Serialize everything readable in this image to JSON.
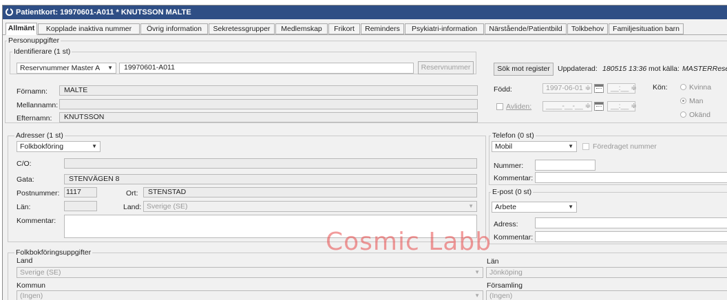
{
  "window": {
    "title": "Patientkort: 19970601-A011 * KNUTSSON MALTE"
  },
  "tabs": [
    {
      "label": "Allmänt"
    },
    {
      "label": "Kopplade inaktiva nummer"
    },
    {
      "label": "Övrig information"
    },
    {
      "label": "Sekretessgrupper"
    },
    {
      "label": "Medlemskap"
    },
    {
      "label": "Frikort"
    },
    {
      "label": "Reminders"
    },
    {
      "label": "Psykiatri-information"
    },
    {
      "label": "Närstående/Patientbild"
    },
    {
      "label": "Tolkbehov"
    },
    {
      "label": "Familjesituation barn"
    }
  ],
  "person": {
    "legend": "Personuppgifter",
    "identifiers_legend": "Identifierare (1 st)",
    "id_type": "Reservnummer Master A",
    "id_value": "19970601-A011",
    "reserve_button": "Reservnummer",
    "search_button": "Sök mot register",
    "updated_label": "Uppdaterad:",
    "updated_value": "180515 13:36",
    "source_label": "mot källa:",
    "source_value": "MASTERReserv",
    "first_name_label": "Förnamn:",
    "first_name": "MALTE",
    "middle_name_label": "Mellannamn:",
    "middle_name": "",
    "last_name_label": "Efternamn:",
    "last_name": "KNUTSSON",
    "born_label": "Född:",
    "born_date": "1997-06-01",
    "born_time": "__:__",
    "deceased_label": "Avliden:",
    "deceased_date": "____-__-__",
    "deceased_time": "__:__",
    "gender_label": "Kön:",
    "gender_options": [
      "Kvinna",
      "Man",
      "Okänd"
    ],
    "gender_selected": "Man"
  },
  "addresses": {
    "legend": "Adresser (1 st)",
    "type": "Folkbokföring",
    "co_label": "C/O:",
    "co": "",
    "street_label": "Gata:",
    "street": "STENVÄGEN 8",
    "postal_label": "Postnummer:",
    "postal": "1117",
    "city_label": "Ort:",
    "city": "STENSTAD",
    "county_label": "Län:",
    "county": "",
    "country_label": "Land:",
    "country": "Sverige (SE)",
    "comment_label": "Kommentar:",
    "comment": ""
  },
  "phone": {
    "legend": "Telefon (0 st)",
    "type": "Mobil",
    "preferred_label": "Föredraget nummer",
    "number_label": "Nummer:",
    "number": "",
    "comment_label": "Kommentar:",
    "comment": ""
  },
  "email": {
    "legend": "E-post (0 st)",
    "type": "Arbete",
    "address_label": "Adress:",
    "address": "",
    "comment_label": "Kommentar:",
    "comment": ""
  },
  "registry": {
    "legend": "Folkbokföringsuppgifter",
    "country_label": "Land",
    "country": "Sverige (SE)",
    "county_label": "Län",
    "county": "Jönköping",
    "municipality_label": "Kommun",
    "municipality": "(Ingen)",
    "parish_label": "Församling",
    "parish": "(Ingen)"
  },
  "watermark": "Cosmic Labb",
  "colors": {
    "titlebar": "#2e4e85",
    "watermark": "#e84a4a"
  }
}
